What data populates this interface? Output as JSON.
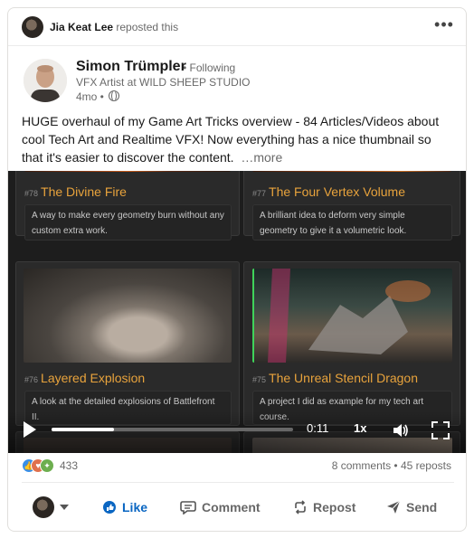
{
  "repost": {
    "name": "Jia Keat Lee",
    "action": " reposted this",
    "more_icon": "ellipsis-icon"
  },
  "author": {
    "name": "Simon Trümpler",
    "following": "• Following",
    "headline": "VFX Artist at WILD SHEEP STUDIO",
    "time": "4mo •",
    "visibility_icon": "globe-icon"
  },
  "post": {
    "text": "HUGE overhaul of my Game Art Tricks overview - 84 Articles/Videos about cool Tech Art and Realtime VFX! Now everything has a nice thumbnail so that it's easier to discover the content.",
    "more_label": "…more"
  },
  "video": {
    "tiles": [
      {
        "num": "#78",
        "title": "The Divine Fire",
        "desc": "A way to make every geometry burn without any custom extra work."
      },
      {
        "num": "#77",
        "title": "The Four Vertex Volume",
        "desc": "A brilliant idea to deform very simple geometry to give it a volumetric look."
      },
      {
        "num": "#76",
        "title": "Layered Explosion",
        "desc": "A look at the detailed explosions of Battlefront II."
      },
      {
        "num": "#75",
        "title": "The Unreal Stencil Dragon",
        "desc": "A project I did as example for my tech art course."
      }
    ],
    "time": "0:11",
    "speed": "1x",
    "progress": 0.26
  },
  "social": {
    "reaction_count": "433",
    "comments": "8 comments",
    "reposts": "45 reposts",
    "separator": " • "
  },
  "actions": {
    "like": "Like",
    "comment": "Comment",
    "repost": "Repost",
    "send": "Send"
  },
  "colors": {
    "accent": "#0a66c2",
    "tile_title": "#e8a33c"
  }
}
